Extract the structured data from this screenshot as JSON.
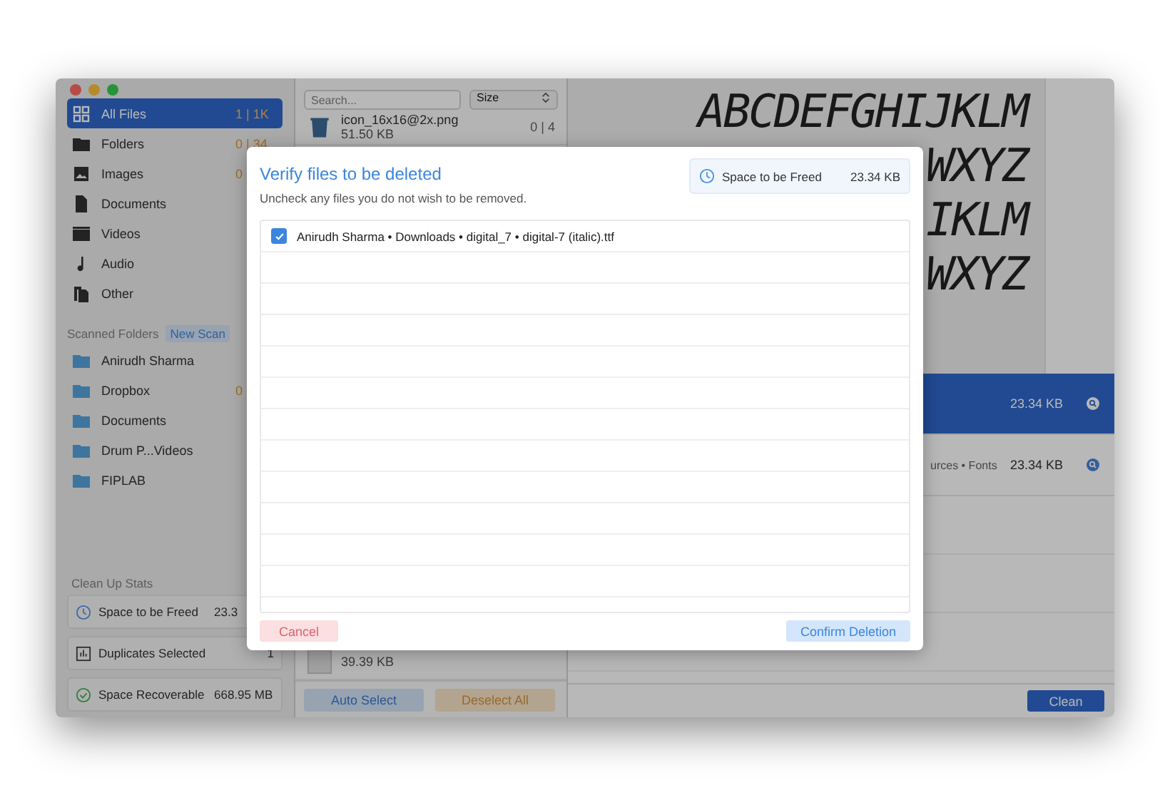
{
  "sidebar": {
    "items": [
      {
        "label": "All Files",
        "count": "1 | 1K",
        "selected": true
      },
      {
        "label": "Folders",
        "count": "0 | 34",
        "selected": false
      },
      {
        "label": "Images",
        "count": "0",
        "selected": false
      },
      {
        "label": "Documents",
        "selected": false
      },
      {
        "label": "Videos",
        "selected": false
      },
      {
        "label": "Audio",
        "selected": false
      },
      {
        "label": "Other",
        "selected": false
      }
    ],
    "scanned_title": "Scanned Folders",
    "new_scan": "New Scan",
    "folders": [
      {
        "label": "Anirudh Sharma"
      },
      {
        "label": "Dropbox",
        "count": "0"
      },
      {
        "label": "Documents"
      },
      {
        "label": "Drum P...Videos"
      },
      {
        "label": "FIPLAB"
      }
    ],
    "stats_title": "Clean Up Stats",
    "stats": [
      {
        "label": "Space to be Freed",
        "value": "23.3"
      },
      {
        "label": "Duplicates Selected",
        "value": "1"
      },
      {
        "label": "Space Recoverable",
        "value": "668.95 MB"
      }
    ]
  },
  "files": {
    "search_placeholder": "Search...",
    "sort": "Size",
    "items": [
      {
        "name": "icon_16x16@2x.png",
        "size": "51.50 KB",
        "count": "0 | 4"
      },
      {
        "size": "39.39 KB"
      }
    ],
    "auto_select": "Auto Select",
    "deselect_all": "Deselect All"
  },
  "preview": {
    "lines": [
      "ABCDEFGHIJKLM",
      "WXYZ",
      "IKLM",
      "WXYZ"
    ]
  },
  "results": [
    {
      "size": "23.34 KB",
      "selected": true
    },
    {
      "path": "urces • Fonts",
      "size": "23.34 KB",
      "selected": false
    }
  ],
  "clean": "Clean",
  "dialog": {
    "title": "Verify files to be deleted",
    "subtitle": "Uncheck any files you do not wish to be removed.",
    "stat": {
      "label": "Space to be Freed",
      "value": "23.34 KB"
    },
    "files": [
      {
        "path": "Anirudh Sharma • Downloads • digital_7 • digital-7 (italic).ttf",
        "checked": true
      }
    ],
    "cancel": "Cancel",
    "confirm": "Confirm Deletion"
  }
}
